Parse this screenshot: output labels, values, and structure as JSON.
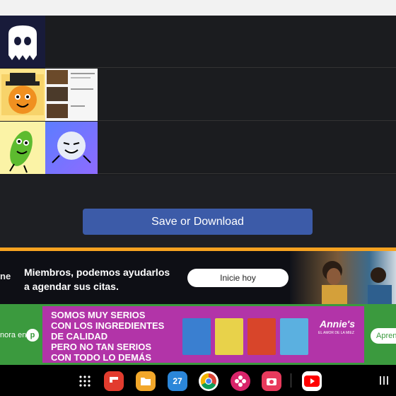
{
  "tiers": [
    {
      "label_icon": "ghost-icon",
      "items": []
    },
    {
      "label_icon": "pirate-character-icon",
      "items": [
        {
          "type": "screenshot",
          "lines": [
            "\"Nicos_kuurmmmmmm...",
            "he stared at timmil",
            "bye"
          ]
        }
      ]
    },
    {
      "label_icon": "bean-character-icon",
      "items": [
        {
          "type": "character",
          "icon": "snowball-character-icon"
        }
      ]
    }
  ],
  "save_button": {
    "label": "Save or Download"
  },
  "ad1": {
    "cut_text": "ne",
    "message_line1": "Miembros, podemos ayudarlos",
    "message_line2": "a agendar sus citas.",
    "cta": "Inicie hoy"
  },
  "ad2": {
    "left_text": "nora en",
    "coin": "p",
    "headline": [
      "SOMOS MUY SERIOS",
      "CON LOS INGREDIENTES",
      "DE CALIDAD",
      "PERO NO TAN SERIOS",
      "CON TODO LO DEMÁS"
    ],
    "brand": "Annie's",
    "tagline": "EL AMOR DE LA MIEZ",
    "cta": "Apren"
  },
  "taskbar": {
    "calendar_day": "27",
    "apps": [
      "apps-grid-icon",
      "flipboard-icon",
      "files-icon",
      "calendar-icon",
      "chrome-icon",
      "flower-icon",
      "camera-icon",
      "youtube-icon"
    ]
  },
  "colors": {
    "accent_button": "#3c5ba8",
    "orange_line": "#f6a220",
    "ad_green": "#3b9a3e",
    "ad_purple": "#b234a8"
  }
}
